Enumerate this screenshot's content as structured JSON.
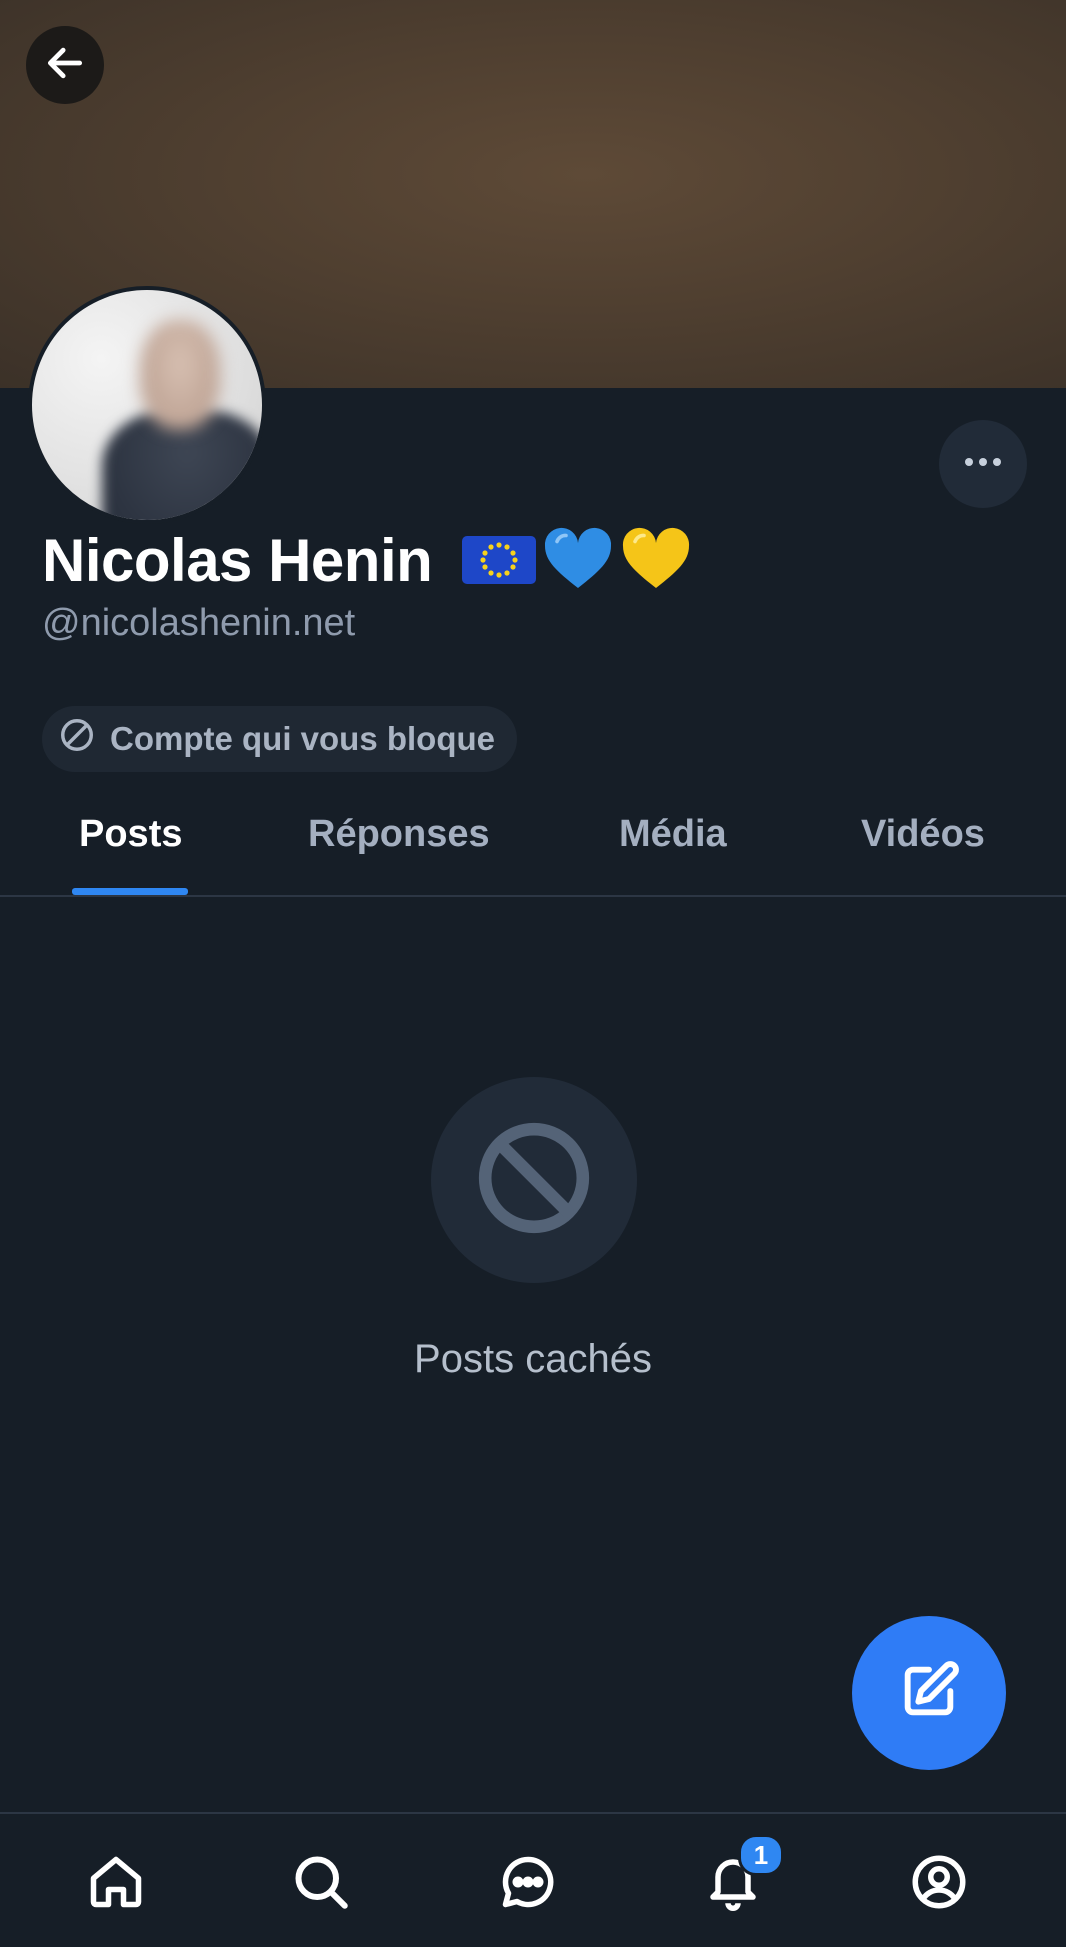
{
  "profile": {
    "display_name": "Nicolas Henin",
    "name_emojis": [
      "eu-flag",
      "blue-heart",
      "yellow-heart"
    ],
    "handle": "@nicolashenin.net",
    "blocked_label": "Compte qui vous bloque"
  },
  "tabs": [
    {
      "label": "Posts",
      "active": true
    },
    {
      "label": "Réponses",
      "active": false
    },
    {
      "label": "Média",
      "active": false
    },
    {
      "label": "Vidéos",
      "active": false
    }
  ],
  "empty_state": {
    "message": "Posts cachés",
    "icon": "block-icon"
  },
  "bottom_nav": {
    "items": [
      "home-icon",
      "search-icon",
      "chat-icon",
      "bell-icon",
      "profile-icon"
    ],
    "notifications_badge": "1"
  },
  "colors": {
    "background": "#161e27",
    "accent": "#2f87f2",
    "fab": "#2f7cf6"
  }
}
